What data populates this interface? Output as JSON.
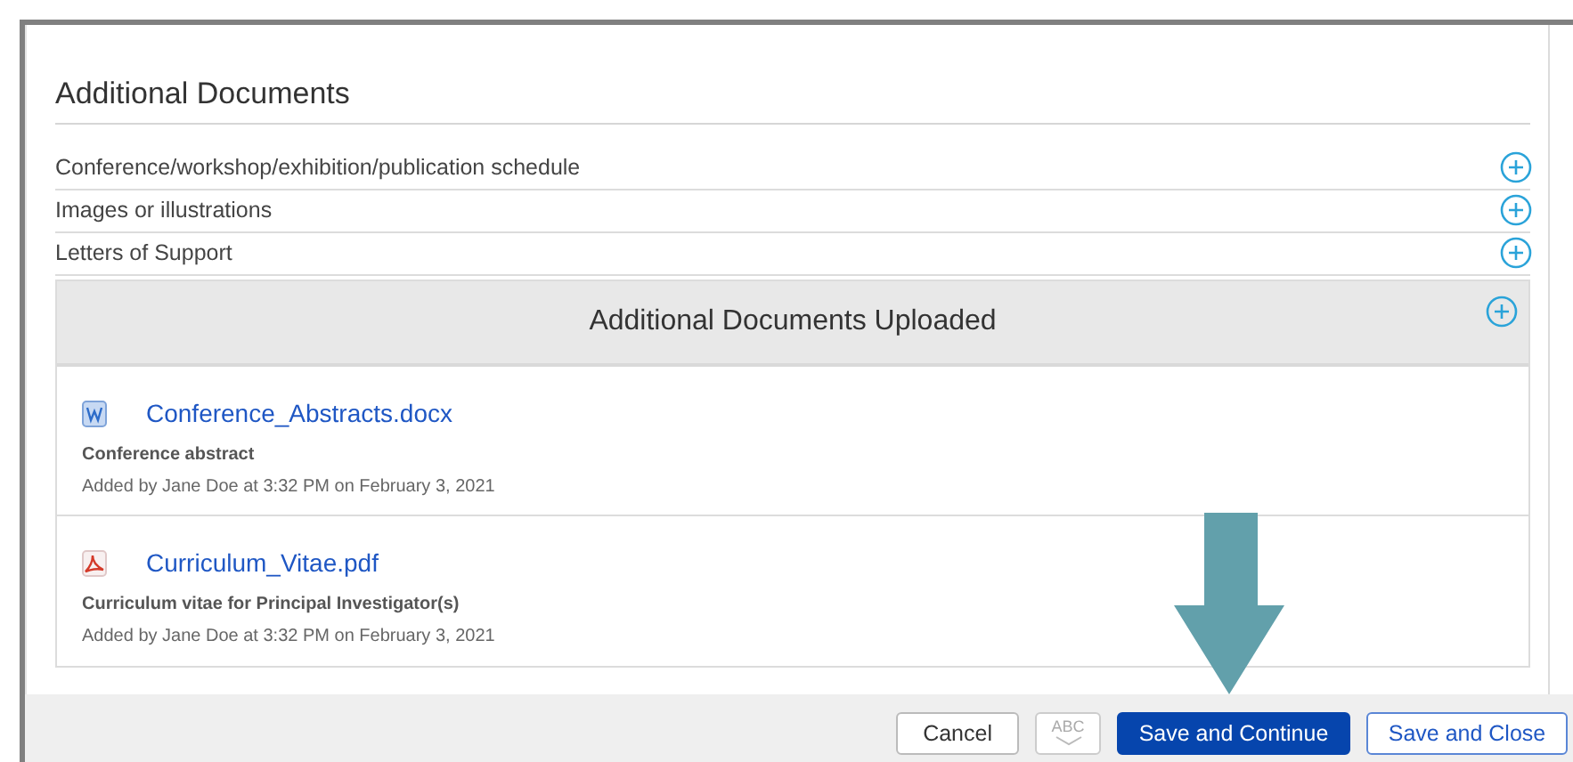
{
  "section": {
    "title": "Additional Documents",
    "items": [
      {
        "label": "Conference/workshop/exhibition/publication schedule"
      },
      {
        "label": "Images or illustrations"
      },
      {
        "label": "Letters of Support"
      }
    ]
  },
  "uploaded": {
    "title": "Additional Documents Uploaded",
    "files": [
      {
        "kind": "word",
        "name": "Conference_Abstracts.docx",
        "description": "Conference abstract",
        "added": "Added by Jane Doe at 3:32 PM on February 3, 2021"
      },
      {
        "kind": "pdf",
        "name": "Curriculum_Vitae.pdf",
        "description": "Curriculum vitae for Principal Investigator(s)",
        "added": "Added by Jane Doe at 3:32 PM on February 3, 2021"
      }
    ]
  },
  "footer": {
    "buttons": [
      {
        "kind": "default",
        "label": "Cancel",
        "disabled": false
      },
      {
        "kind": "spellcheck",
        "label": "ABC",
        "disabled": true
      },
      {
        "kind": "primary",
        "label": "Save and Continue",
        "disabled": false
      },
      {
        "kind": "outline",
        "label": "Save and Close",
        "disabled": false
      }
    ]
  }
}
